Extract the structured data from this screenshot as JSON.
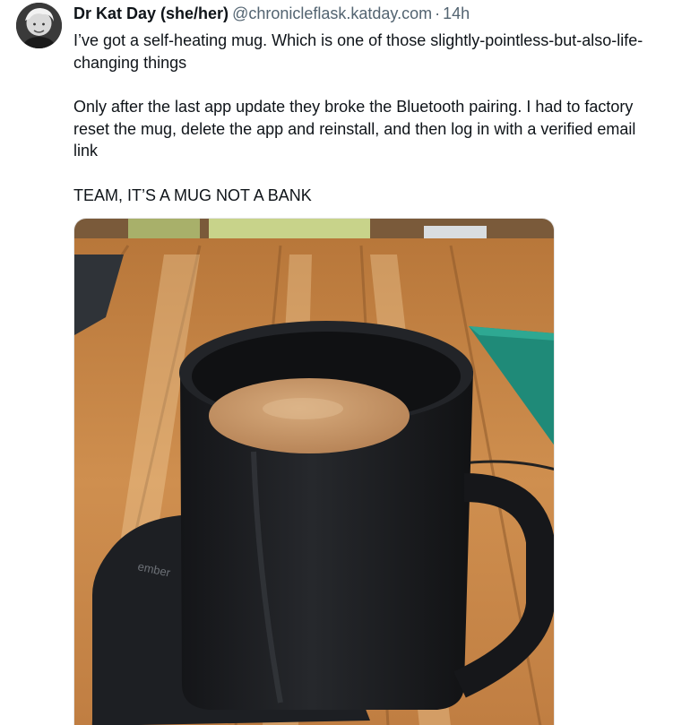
{
  "post": {
    "author": {
      "display_name": "Dr Kat Day (she/her)",
      "handle": "@chronicleflask.katday.com",
      "separator": "·",
      "time": "14h",
      "avatar_icon": "avatar-photo"
    },
    "paragraphs": [
      "I’ve got a self-heating mug. Which is one of those slightly-pointless-but-also-life-changing things",
      "Only after the last app update they broke the Bluetooth pairing. I had to factory reset the mug, delete the app and reinstall, and then log in with a verified email link",
      "TEAM, IT’S A MUG NOT A BANK"
    ],
    "media": {
      "coaster_text": "ember"
    }
  },
  "colors": {
    "text": "#0f1419",
    "muted": "#536471",
    "table_wood": "#c98a4a",
    "mug": "#1c1d20",
    "coffee": "#c99a6c",
    "cutting_mat": "#1f8a78"
  }
}
